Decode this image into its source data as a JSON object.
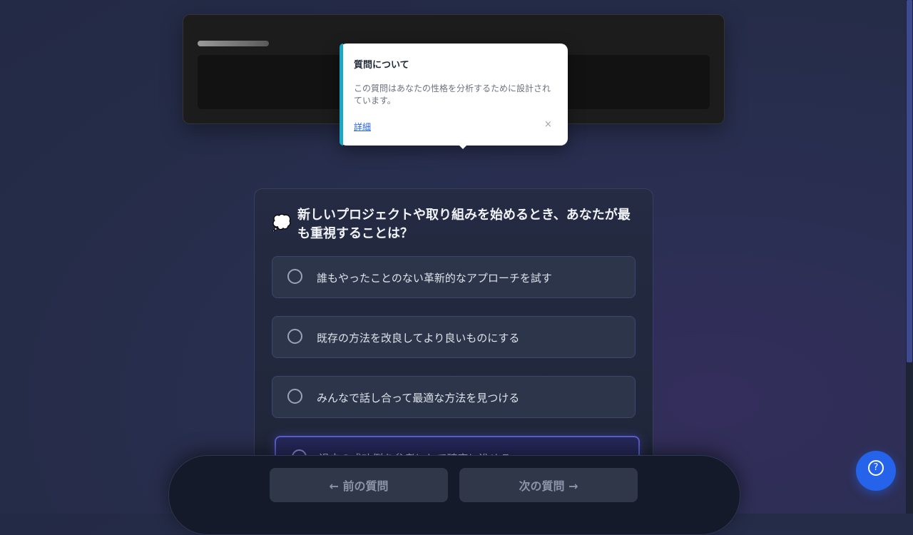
{
  "tooltip": {
    "title": "質問について",
    "body": "この質問はあなたの性格を分析するために設計されています。",
    "link": "詳細",
    "close": "×"
  },
  "question": {
    "icon": "💭",
    "text": "新しいプロジェクトや取り組みを始めるとき、あなたが最も重視することは？",
    "options": [
      "誰もやったことのない革新的なアプローチを試す",
      "既存の方法を改良してより良いものにする",
      "みんなで話し合って最適な方法を見つける",
      "過去の成功例を参考にして確実に進める"
    ]
  },
  "nav": {
    "prev": "← 前の質問",
    "next": "次の質問 →"
  },
  "help": {
    "glyph": "?"
  },
  "icons": {
    "question": "thought-bubble-icon",
    "help": "help-icon",
    "close": "close-icon"
  },
  "colors": {
    "accent": "#1ba8c7",
    "help": "#2563eb",
    "selected_border": "#5a5fd6"
  }
}
